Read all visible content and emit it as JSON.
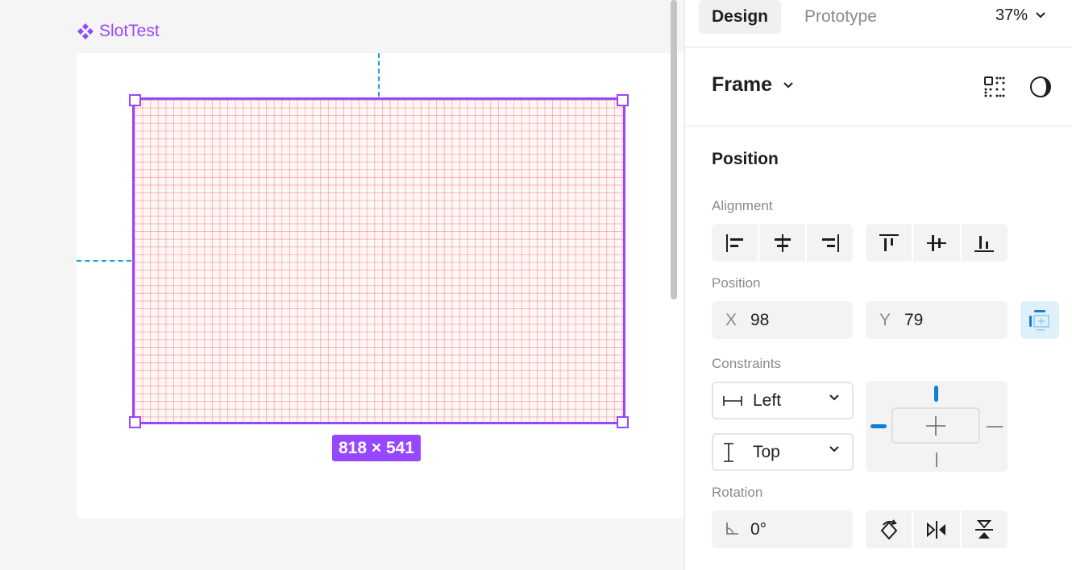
{
  "canvas": {
    "frame_label": "SlotTest",
    "size_badge": "818 × 541"
  },
  "panel": {
    "tabs": {
      "design": "Design",
      "prototype": "Prototype"
    },
    "zoom": "37%",
    "frame_title": "Frame",
    "position_section": {
      "title": "Position",
      "alignment_label": "Alignment",
      "position_label": "Position",
      "x_prefix": "X",
      "x_value": "98",
      "y_prefix": "Y",
      "y_value": "79",
      "constraints_label": "Constraints",
      "horizontal_constraint": "Left",
      "vertical_constraint": "Top",
      "rotation_label": "Rotation",
      "rotation_value": "0°"
    }
  },
  "colors": {
    "accent": "#9747ff",
    "guide": "#17a0d8",
    "constraint_active": "#0d7fd8",
    "grid_line": "#f48080"
  }
}
